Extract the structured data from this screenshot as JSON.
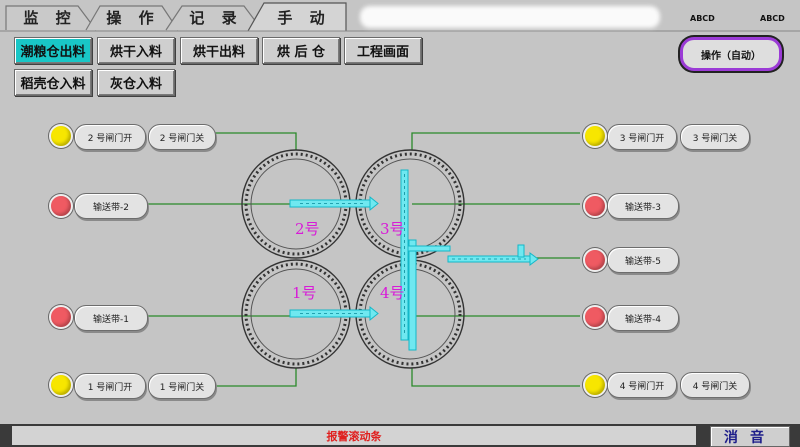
{
  "tabs": [
    "监 控",
    "操 作",
    "记 录",
    "手 动"
  ],
  "active_tab": "手 动",
  "corner_labels": [
    "ABCD",
    "ABCD"
  ],
  "buttons": {
    "row1": [
      "潮粮仓出料",
      "烘干入料",
      "烘干出料",
      "烘 后 仓",
      "工程画面"
    ],
    "row2": [
      "稻壳仓入料",
      "灰仓入料"
    ]
  },
  "mode_button": "操作（自动）",
  "left_controls": {
    "gate2_open": "2 号闸门开",
    "gate2_close": "2 号闸门关",
    "conveyor2": "输送带-2",
    "conveyor1": "输送带-1",
    "gate1_open": "1 号闸门开",
    "gate1_close": "1 号闸门关"
  },
  "right_controls": {
    "gate3_open": "3 号闸门开",
    "gate3_close": "3 号闸门关",
    "conveyor3": "输送带-3",
    "conveyor5": "输送带-5",
    "conveyor4": "输送带-4",
    "gate4_open": "4 号闸门开",
    "gate4_close": "4 号闸门关"
  },
  "bins": [
    "2号",
    "3号",
    "1号",
    "4号"
  ],
  "alarm_text": "报警滚动条",
  "mute_label": "消音",
  "colors": {
    "lamp_yellow": "#f7e600",
    "lamp_red": "#ef5a62",
    "active_button": "#19c6c6",
    "conveyor": "#19d8e8",
    "bin_label": "#d81ad8",
    "line": "#2a8a2a",
    "mode_border": "#9b3bd6",
    "alarm_text": "#e0201f"
  }
}
